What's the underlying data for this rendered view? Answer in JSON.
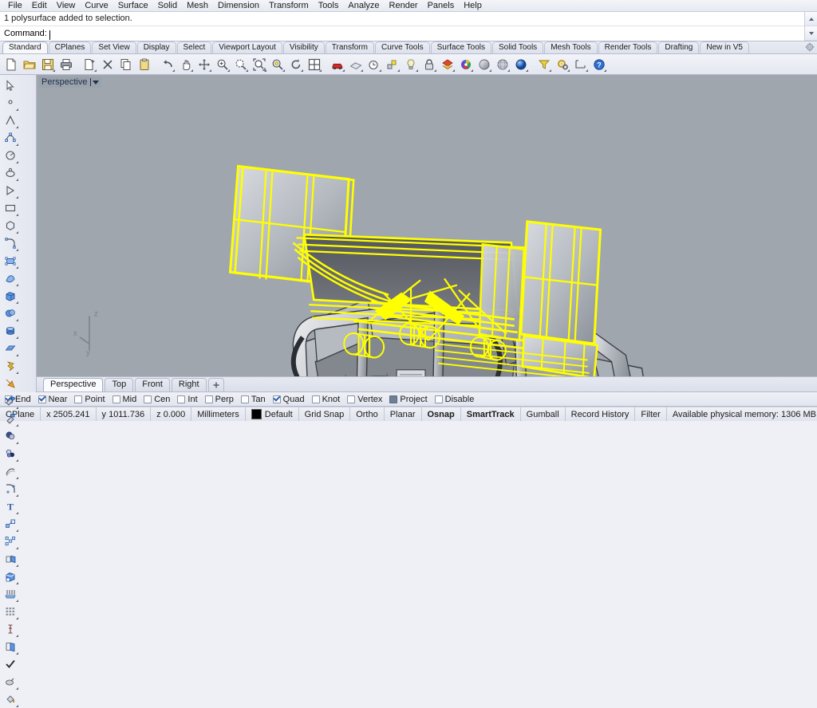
{
  "app": {
    "title": "Rhinoceros",
    "accent": "#2b5fa8",
    "selection_color": "#ffff00",
    "viewport_bg": "#a0a6ae"
  },
  "menubar": {
    "items": [
      {
        "label": "File"
      },
      {
        "label": "Edit"
      },
      {
        "label": "View"
      },
      {
        "label": "Curve"
      },
      {
        "label": "Surface"
      },
      {
        "label": "Solid"
      },
      {
        "label": "Mesh"
      },
      {
        "label": "Dimension"
      },
      {
        "label": "Transform"
      },
      {
        "label": "Tools"
      },
      {
        "label": "Analyze"
      },
      {
        "label": "Render"
      },
      {
        "label": "Panels"
      },
      {
        "label": "Help"
      }
    ]
  },
  "command_area": {
    "history": "1 polysurface added to selection.",
    "prompt_label": "Command:",
    "input_value": "",
    "scroll_up_icon": "triangle-up-icon",
    "scroll_down_icon": "triangle-down-icon"
  },
  "toolbar_tabs": {
    "active": "Standard",
    "items": [
      {
        "label": "Standard"
      },
      {
        "label": "CPlanes"
      },
      {
        "label": "Set View"
      },
      {
        "label": "Display"
      },
      {
        "label": "Select"
      },
      {
        "label": "Viewport Layout"
      },
      {
        "label": "Visibility"
      },
      {
        "label": "Transform"
      },
      {
        "label": "Curve Tools"
      },
      {
        "label": "Surface Tools"
      },
      {
        "label": "Solid Tools"
      },
      {
        "label": "Mesh Tools"
      },
      {
        "label": "Render Tools"
      },
      {
        "label": "Drafting"
      },
      {
        "label": "New in V5"
      }
    ],
    "options_icon": "gear-icon"
  },
  "main_toolbar": {
    "buttons": [
      {
        "icon": "new-file-icon",
        "flyout": false
      },
      {
        "icon": "open-folder-icon",
        "flyout": false
      },
      {
        "icon": "save-icon",
        "flyout": false
      },
      {
        "icon": "print-icon",
        "flyout": false
      },
      {
        "icon": "cut-page-icon",
        "flyout": true
      },
      {
        "icon": "delete-x-icon",
        "flyout": false
      },
      {
        "icon": "copy-icon",
        "flyout": false
      },
      {
        "icon": "paste-clipboard-icon",
        "flyout": false
      },
      {
        "icon": "undo-arrow-icon",
        "flyout": true
      },
      {
        "icon": "pan-hand-icon",
        "flyout": true
      },
      {
        "icon": "move-cross-icon",
        "flyout": true
      },
      {
        "icon": "zoom-in-icon",
        "flyout": true
      },
      {
        "icon": "zoom-dynamic-icon",
        "flyout": true
      },
      {
        "icon": "zoom-extents-icon",
        "flyout": true
      },
      {
        "icon": "zoom-selected-icon",
        "flyout": true
      },
      {
        "icon": "rotate-view-icon",
        "flyout": true
      },
      {
        "icon": "viewport-layout-icon",
        "flyout": true
      },
      {
        "icon": "render-car-icon",
        "flyout": true
      },
      {
        "icon": "materials-icon",
        "flyout": true
      },
      {
        "icon": "history-clock-icon",
        "flyout": true
      },
      {
        "icon": "properties-icon",
        "flyout": true
      },
      {
        "icon": "light-bulb-icon",
        "flyout": true
      },
      {
        "icon": "lock-icon",
        "flyout": true
      },
      {
        "icon": "layers-icon",
        "flyout": true
      },
      {
        "icon": "color-wheel-icon",
        "flyout": true
      },
      {
        "icon": "shaded-sphere-icon",
        "flyout": true
      },
      {
        "icon": "ghosted-sphere-icon",
        "flyout": true
      },
      {
        "icon": "rendered-sphere-icon",
        "flyout": true
      },
      {
        "icon": "select-filter-icon",
        "flyout": true
      },
      {
        "icon": "options-gears-icon",
        "flyout": true
      },
      {
        "icon": "dimension-icon",
        "flyout": true
      },
      {
        "icon": "help-icon",
        "flyout": true
      }
    ]
  },
  "left_toolbar": {
    "buttons": [
      {
        "icon": "select-arrow-icon"
      },
      {
        "icon": "point-icon"
      },
      {
        "icon": "polyline-icon"
      },
      {
        "icon": "curve-control-points-icon"
      },
      {
        "icon": "arc-icon"
      },
      {
        "icon": "ellipse-icon"
      },
      {
        "icon": "triangle-icon"
      },
      {
        "icon": "rectangle-icon"
      },
      {
        "icon": "polygon-icon"
      },
      {
        "icon": "fillet-curve-icon"
      },
      {
        "icon": "surface-control-points-icon"
      },
      {
        "icon": "surface-loft-icon"
      },
      {
        "icon": "box-icon"
      },
      {
        "icon": "sphere-boolean-icon"
      },
      {
        "icon": "cylinder-icon"
      },
      {
        "icon": "surface-plane-icon"
      },
      {
        "icon": "explode-icon"
      },
      {
        "icon": "boolean-arrow-icon"
      },
      {
        "icon": "trim-icon"
      },
      {
        "icon": "split-icon"
      },
      {
        "icon": "boolean-union-icon"
      },
      {
        "icon": "boolean-difference-icon"
      },
      {
        "icon": "offset-curve-icon"
      },
      {
        "icon": "fillet-surface-icon"
      },
      {
        "icon": "text-tool-icon"
      },
      {
        "icon": "scale-icon"
      },
      {
        "icon": "array-icon"
      },
      {
        "icon": "mirror-icon"
      },
      {
        "icon": "cap-solid-icon"
      },
      {
        "icon": "extrude-icon"
      },
      {
        "icon": "array-grid-icon"
      },
      {
        "icon": "dimension-linear-icon"
      },
      {
        "icon": "layer-book-icon"
      },
      {
        "icon": "check-mark-icon"
      },
      {
        "icon": "render-preview-icon"
      },
      {
        "icon": "paint-bucket-icon"
      }
    ]
  },
  "viewport": {
    "label": "Perspective",
    "dropdown_icon": "chevron-down-icon",
    "axis_labels": {
      "x": "x",
      "y": "y",
      "z": "z"
    },
    "tabs": [
      {
        "label": "Perspective",
        "active": true
      },
      {
        "label": "Top",
        "active": false
      },
      {
        "label": "Front",
        "active": false
      },
      {
        "label": "Right",
        "active": false
      }
    ],
    "add_tab_icon": "plus-icon"
  },
  "osnap": {
    "items": [
      {
        "label": "End",
        "state": "checked"
      },
      {
        "label": "Near",
        "state": "checked"
      },
      {
        "label": "Point",
        "state": "unchecked"
      },
      {
        "label": "Mid",
        "state": "unchecked"
      },
      {
        "label": "Cen",
        "state": "unchecked"
      },
      {
        "label": "Int",
        "state": "unchecked"
      },
      {
        "label": "Perp",
        "state": "unchecked"
      },
      {
        "label": "Tan",
        "state": "unchecked"
      },
      {
        "label": "Quad",
        "state": "checked"
      },
      {
        "label": "Knot",
        "state": "unchecked"
      },
      {
        "label": "Vertex",
        "state": "unchecked"
      },
      {
        "label": "Project",
        "state": "filled"
      },
      {
        "label": "Disable",
        "state": "unchecked"
      }
    ]
  },
  "statusbar": {
    "cplane_label": "CPlane",
    "coord_x": "x 2505.241",
    "coord_y": "y 1011.736",
    "coord_z": "z 0.000",
    "units": "Millimeters",
    "layer_name": "Default",
    "layer_color": "#000000",
    "toggles": [
      {
        "label": "Grid Snap",
        "active": false
      },
      {
        "label": "Ortho",
        "active": false
      },
      {
        "label": "Planar",
        "active": false
      },
      {
        "label": "Osnap",
        "active": true
      },
      {
        "label": "SmartTrack",
        "active": true
      },
      {
        "label": "Gumball",
        "active": false
      },
      {
        "label": "Record History",
        "active": false
      },
      {
        "label": "Filter",
        "active": false
      }
    ],
    "memory": "Available physical memory: 1306 MB"
  }
}
